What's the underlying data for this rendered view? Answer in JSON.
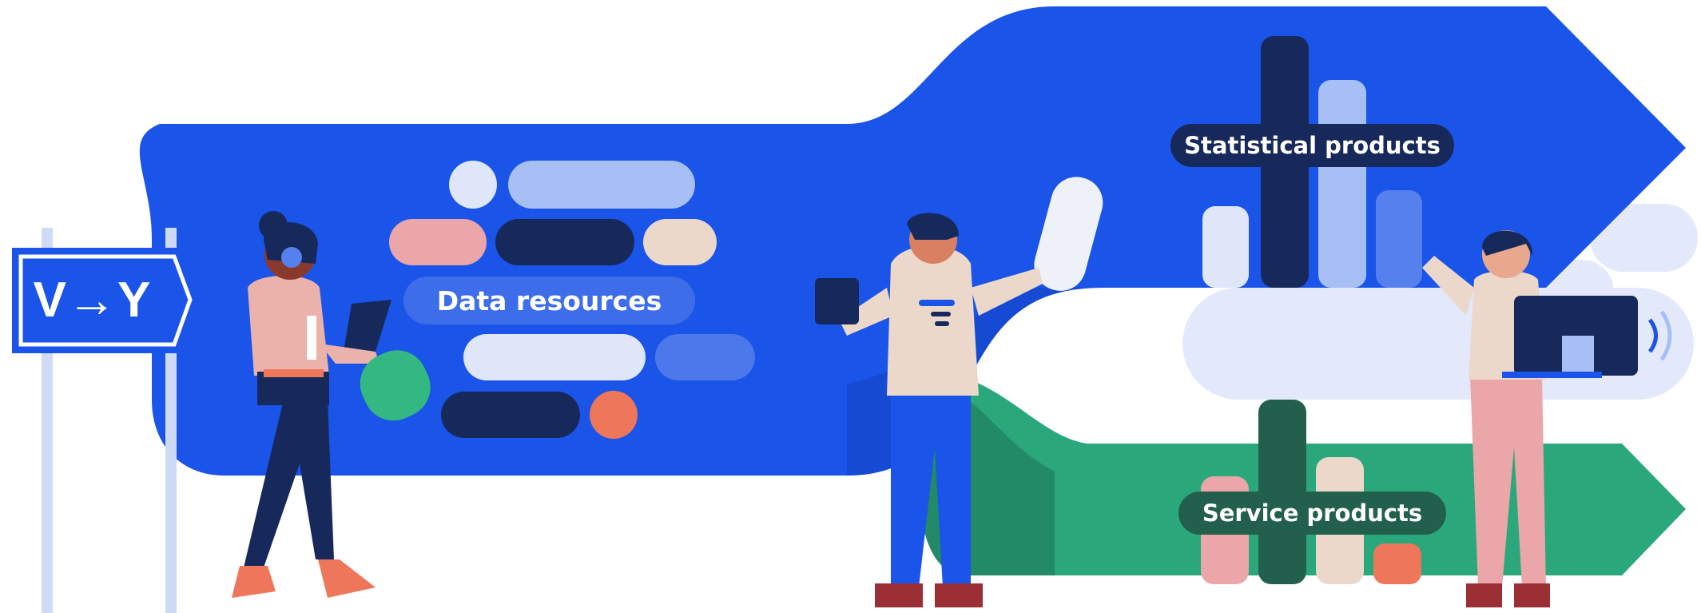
{
  "sign": {
    "text": "V→Y"
  },
  "labels": {
    "data_resources": "Data resources",
    "statistical_products": "Statistical products",
    "service_products": "Service products"
  },
  "colors": {
    "blue": "#1a54e8",
    "green": "#2aa77b",
    "navy": "#17285a",
    "light_blue": "#a8bff5",
    "pale_blue": "#dfe6fa",
    "pink": "#eaa6a8",
    "beige": "#ebd8cb",
    "orange": "#ee775b",
    "dark_green": "#22604d"
  }
}
